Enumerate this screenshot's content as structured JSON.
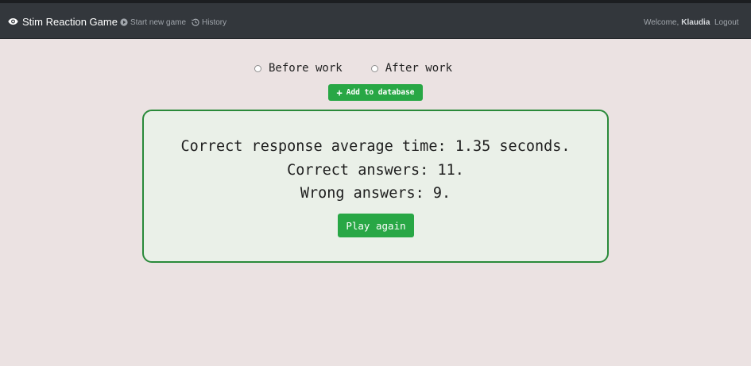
{
  "navbar": {
    "brand": "Stim Reaction Game",
    "links": {
      "start_new_game": "Start new game",
      "history": "History"
    },
    "welcome_prefix": "Welcome,",
    "username": "Klaudia",
    "logout": "Logout"
  },
  "options": {
    "before_work": "Before work",
    "after_work": "After work"
  },
  "add_button": "Add to database",
  "results": {
    "average_time": "Correct response average time: 1.35 seconds.",
    "correct": "Correct answers: 11.",
    "wrong": "Wrong answers: 9."
  },
  "play_again": "Play again",
  "colors": {
    "navbar_bg": "#33373c",
    "page_bg": "#ebe2e2",
    "accent_green": "#28a745",
    "result_border": "#2a8a3a",
    "result_bg": "#eaf0e8"
  },
  "icons": {
    "brand": "eye-icon",
    "start_new_game": "play-circle-icon",
    "history": "history-icon",
    "add": "plus-icon"
  }
}
